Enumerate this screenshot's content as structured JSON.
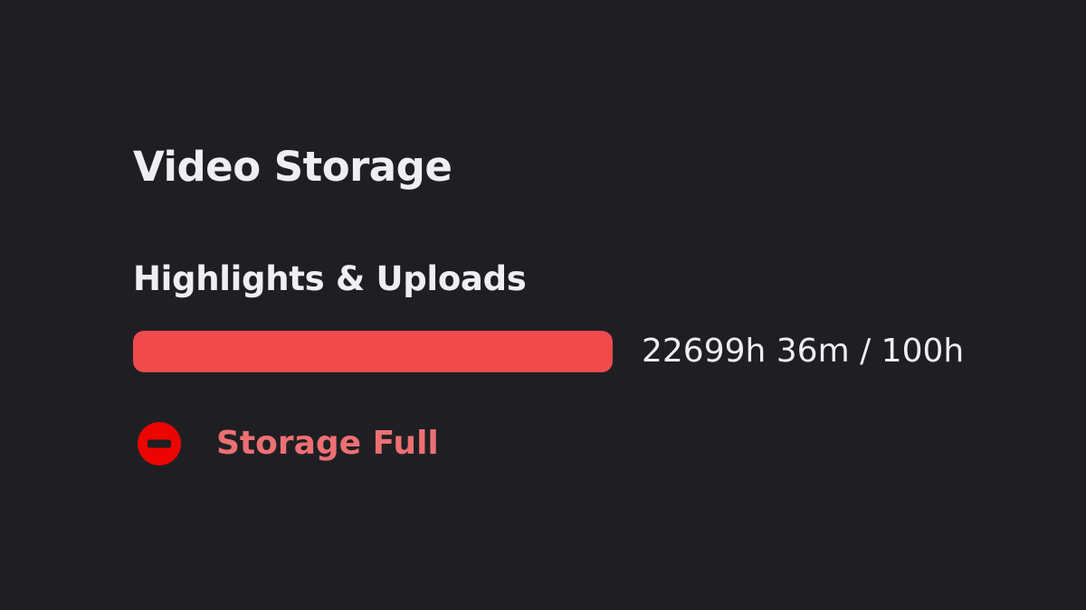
{
  "section": {
    "title": "Video Storage"
  },
  "highlights": {
    "label": "Highlights & Uploads",
    "usage_text": "22699h 36m / 100h",
    "usage_fraction": 1.0
  },
  "status": {
    "icon": "minus-circle-icon",
    "text": "Storage Full"
  },
  "colors": {
    "bar_fill": "#f04a4c",
    "status_icon": "#eb0400",
    "status_text": "#ec7073"
  }
}
